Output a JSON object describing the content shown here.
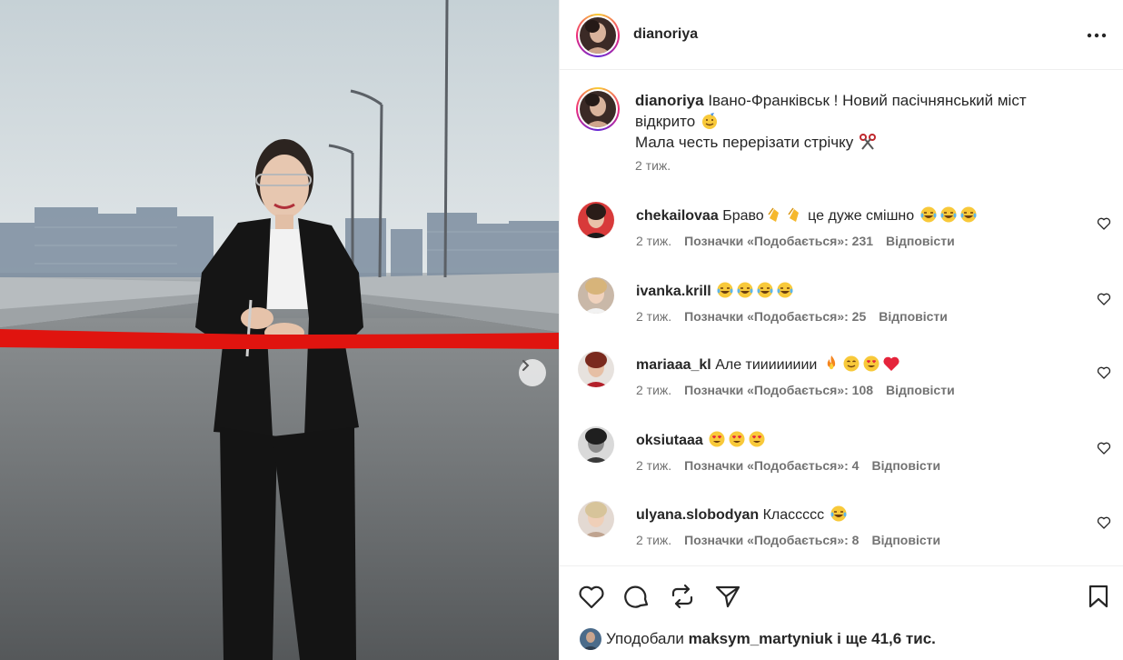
{
  "post": {
    "username": "dianoriya",
    "caption_username": "dianoriya",
    "caption_line1": "Івано-Франківськ ! Новий пасічнянський міст відкрито",
    "caption_line2": "Мала честь перерізати стрічку",
    "caption_time": "2 тиж."
  },
  "comments": [
    {
      "username": "chekailovaa",
      "text": "Браво",
      "text2": " це дуже смішно",
      "time": "2 тиж.",
      "likes": "Позначки «Подобається»: 231",
      "reply": "Відповісти"
    },
    {
      "username": "ivanka.krill",
      "text": "",
      "text2": "",
      "time": "2 тиж.",
      "likes": "Позначки «Подобається»: 25",
      "reply": "Відповісти"
    },
    {
      "username": "mariaaa_kl",
      "text": "Але тииииииии",
      "text2": "",
      "time": "2 тиж.",
      "likes": "Позначки «Подобається»: 108",
      "reply": "Відповісти"
    },
    {
      "username": "oksiutaaa",
      "text": "",
      "text2": "",
      "time": "2 тиж.",
      "likes": "Позначки «Подобається»: 4",
      "reply": "Відповісти"
    },
    {
      "username": "ulyana.slobodyan",
      "text": "Классссс",
      "text2": "",
      "time": "2 тиж.",
      "likes": "Позначки «Подобається»: 8",
      "reply": "Відповісти"
    }
  ],
  "likes_summary": {
    "prefix": "Уподобали",
    "user": "maksym_martyniuk",
    "suffix": "і ще 41,6 тис."
  },
  "icons": {
    "more": "more-horizontal-icon",
    "like": "heart-icon",
    "comment": "comment-bubble-icon",
    "repost": "repost-icon",
    "share": "send-icon",
    "save": "bookmark-icon",
    "carousel_next": "chevron-right-icon"
  },
  "colors": {
    "text": "#262626",
    "secondary": "#737373",
    "ribbon": "#e0140f",
    "divider": "#efefef"
  }
}
